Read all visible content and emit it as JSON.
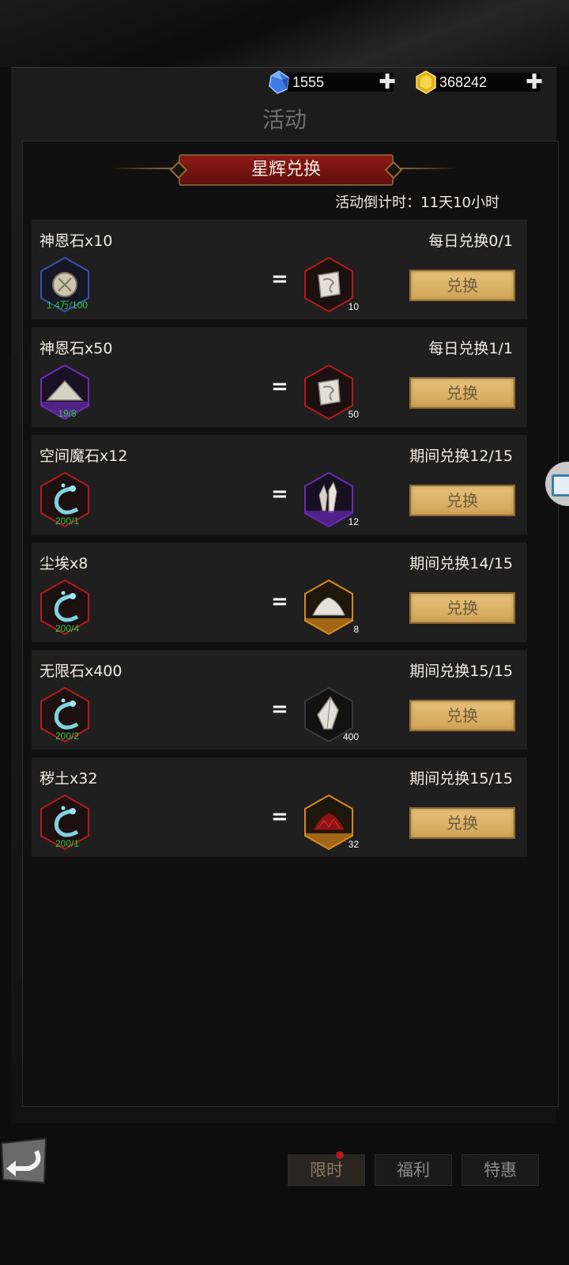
{
  "header": {
    "title": "活动",
    "currencies": [
      {
        "icon": "blue-crystal-icon",
        "value": "1555",
        "plus": "✚"
      },
      {
        "icon": "gold-crystal-icon",
        "value": "368242",
        "plus": "✚"
      }
    ]
  },
  "event": {
    "banner": "星辉兑换",
    "countdown": "活动倒计时：11天10小时"
  },
  "exchanges": [
    {
      "name": "神恩石x10",
      "limit": "每日兑换0/1",
      "cost": "1.4万/100",
      "cost_color": "#2ecc40",
      "reward_count": "10",
      "button": "兑换"
    },
    {
      "name": "神恩石x50",
      "limit": "每日兑换1/1",
      "cost": "19/8",
      "cost_color": "#2ecc40",
      "reward_count": "50",
      "button": "兑换"
    },
    {
      "name": "空间魔石x12",
      "limit": "期间兑换12/15",
      "cost": "200/1",
      "cost_color": "#2ecc40",
      "reward_count": "12",
      "button": "兑换"
    },
    {
      "name": "尘埃x8",
      "limit": "期间兑换14/15",
      "cost": "200/4",
      "cost_color": "#2ecc40",
      "reward_count": "8",
      "button": "兑换"
    },
    {
      "name": "无限石x400",
      "limit": "期间兑换15/15",
      "cost": "200/2",
      "cost_color": "#2ecc40",
      "reward_count": "400",
      "button": "兑换"
    },
    {
      "name": "秽土x32",
      "limit": "期间兑换15/15",
      "cost": "200/1",
      "cost_color": "#2ecc40",
      "reward_count": "32",
      "button": "兑换"
    }
  ],
  "bottom_tabs": [
    {
      "label": "限时",
      "active": true
    },
    {
      "label": "福利",
      "active": false
    },
    {
      "label": "特惠",
      "active": false
    }
  ],
  "colors": {
    "banner_red": "#8f1b16",
    "button_gold": "#e7c27c",
    "rarity_blue": "#3c4fb0",
    "rarity_purple": "#6a2bb5",
    "rarity_red": "#b21c1c",
    "rarity_gold": "#d98a1a"
  }
}
